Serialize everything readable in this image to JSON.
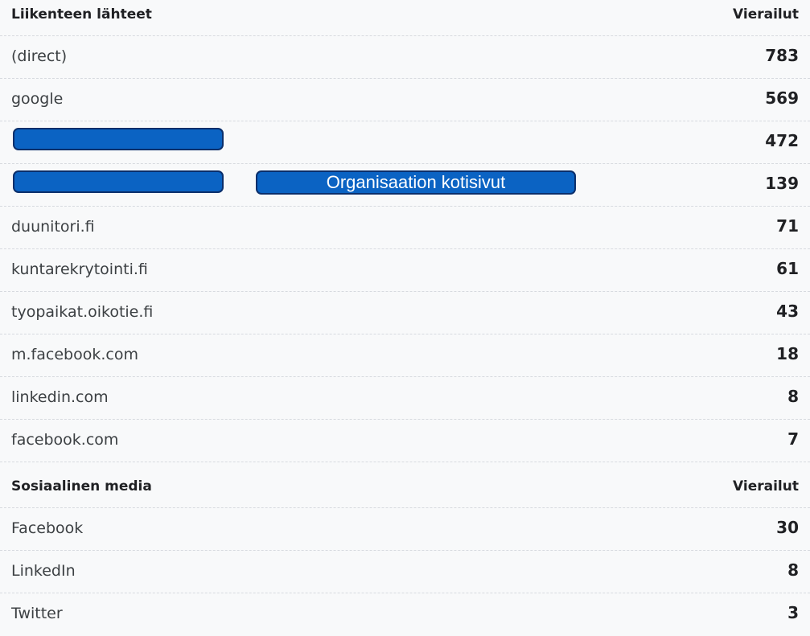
{
  "traffic_sources": {
    "header_label": "Liikenteen lähteet",
    "header_value": "Vierailut",
    "rows": [
      {
        "label": "(direct)",
        "value": "783"
      },
      {
        "label": "google",
        "value": "569"
      },
      {
        "label": "",
        "value": "472",
        "redacted": true
      },
      {
        "label": "",
        "value": "139",
        "redacted": true,
        "annotation": "Organisaation kotisivut"
      },
      {
        "label": "duunitori.fi",
        "value": "71"
      },
      {
        "label": "kuntarekrytointi.fi",
        "value": "61"
      },
      {
        "label": "tyopaikat.oikotie.fi",
        "value": "43"
      },
      {
        "label": "m.facebook.com",
        "value": "18"
      },
      {
        "label": "linkedin.com",
        "value": "8"
      },
      {
        "label": "facebook.com",
        "value": "7"
      }
    ]
  },
  "social_media": {
    "header_label": "Sosiaalinen media",
    "header_value": "Vierailut",
    "rows": [
      {
        "label": "Facebook",
        "value": "30"
      },
      {
        "label": "LinkedIn",
        "value": "8"
      },
      {
        "label": "Twitter",
        "value": "3"
      }
    ]
  },
  "colors": {
    "background": "#f8f9fa",
    "redaction": "#0b63c3",
    "redaction_border": "#0b2f6b"
  }
}
